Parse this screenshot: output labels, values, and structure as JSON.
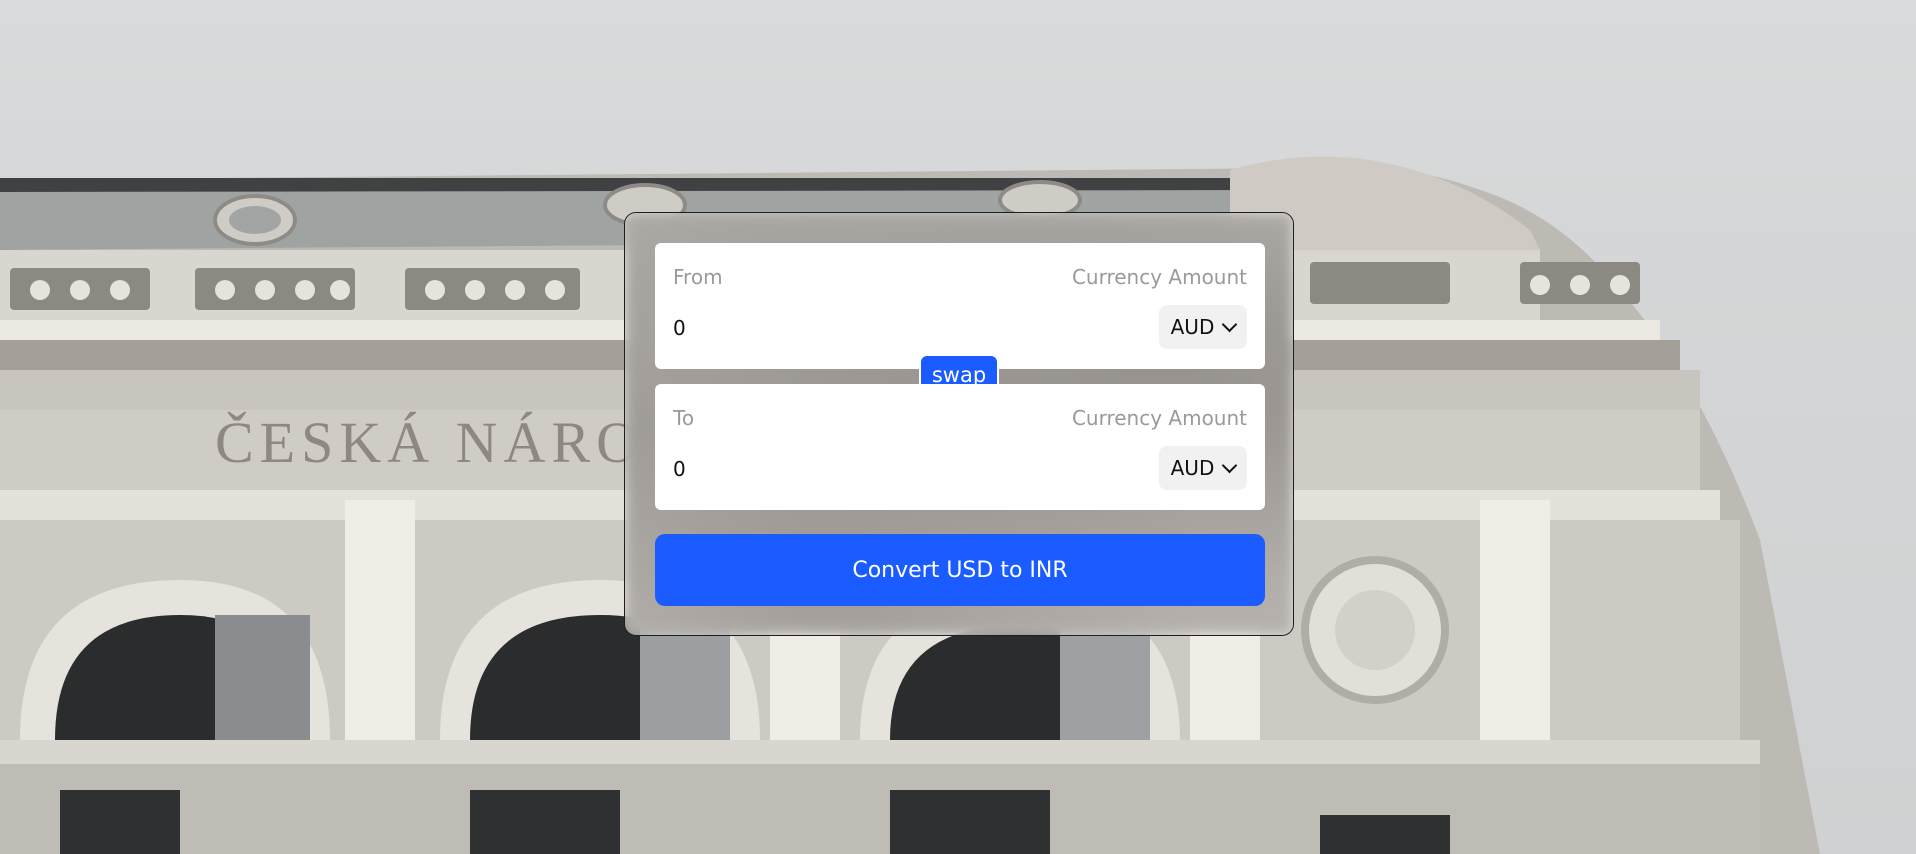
{
  "converter": {
    "from": {
      "label": "From",
      "amount_label": "Currency Amount",
      "amount_value": "0",
      "currency": "AUD"
    },
    "to": {
      "label": "To",
      "amount_label": "Currency Amount",
      "amount_value": "0",
      "currency": "AUD"
    },
    "swap_label": "swap",
    "convert_label": "Convert USD to INR"
  },
  "background": {
    "facade_text": "ČESKÁ NÁRO"
  },
  "colors": {
    "accent": "#1a5cff",
    "panel": "#ffffff",
    "muted_text": "#9a9a9a"
  }
}
